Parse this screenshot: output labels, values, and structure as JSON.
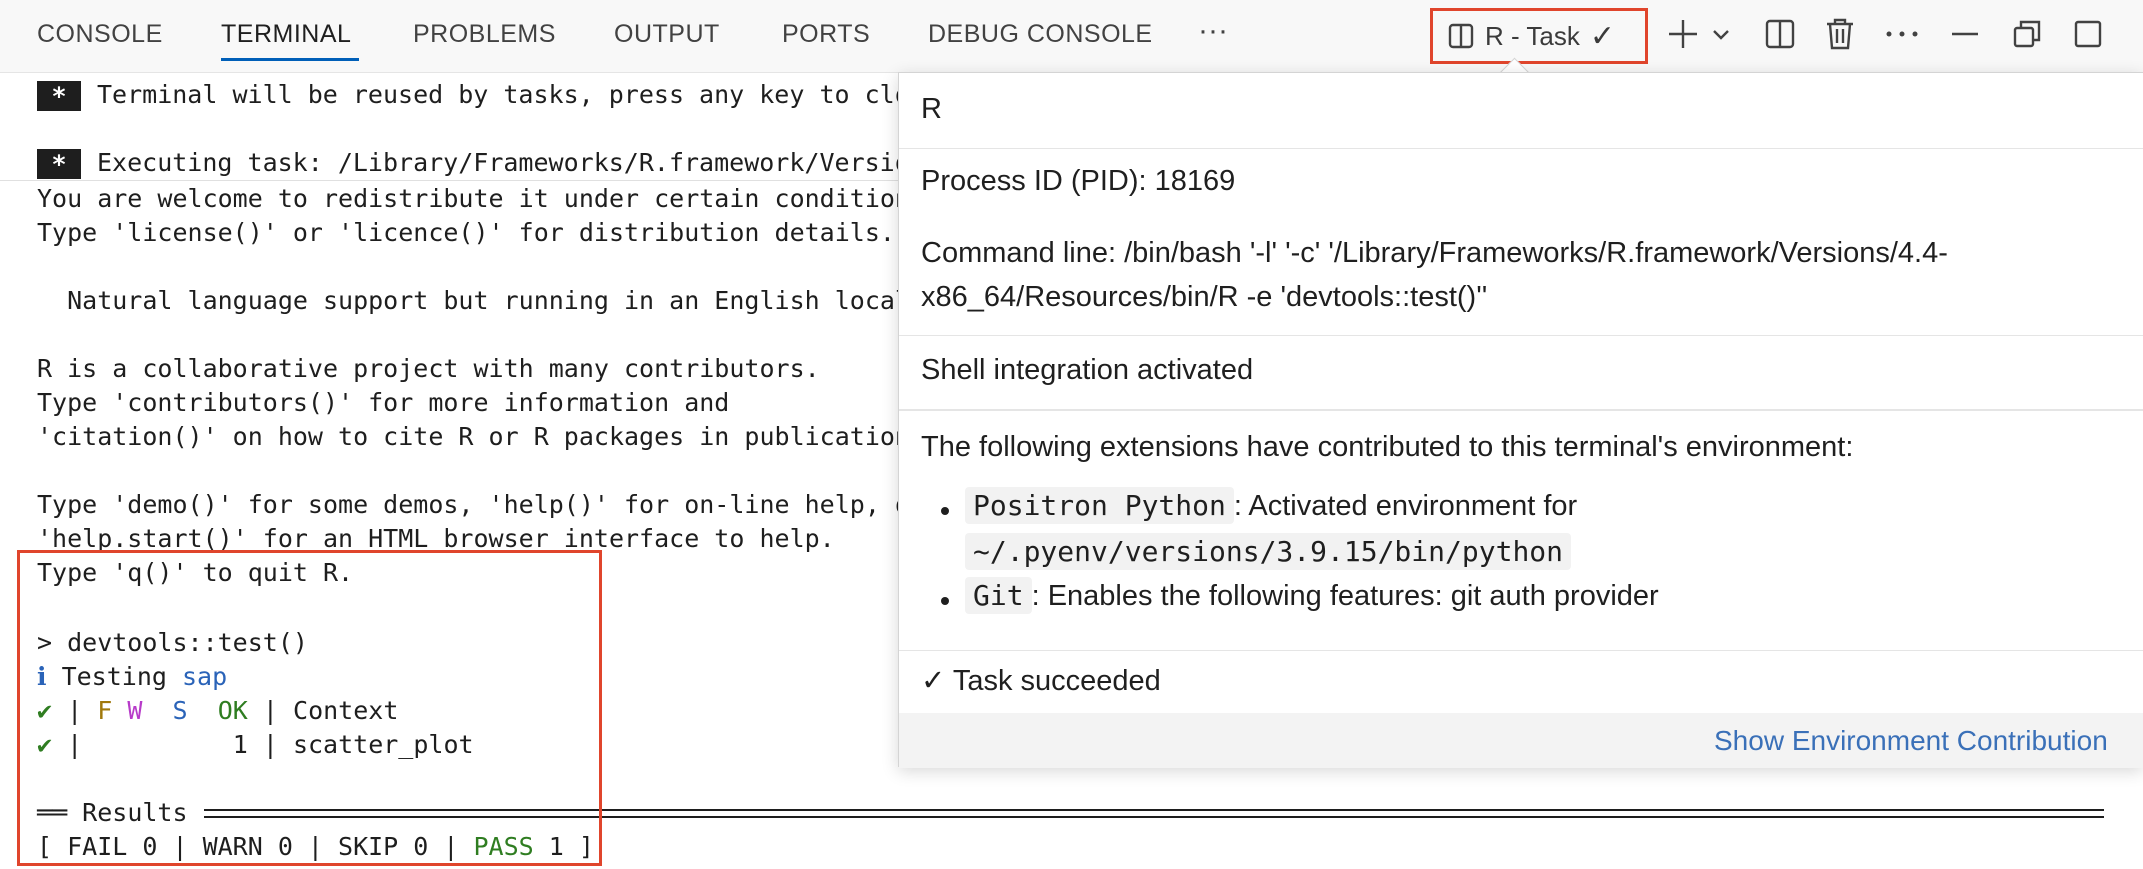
{
  "tabs": [
    "CONSOLE",
    "TERMINAL",
    "PROBLEMS",
    "OUTPUT",
    "PORTS",
    "DEBUG CONSOLE"
  ],
  "active_tab": "TERMINAL",
  "more_label": "···",
  "task_chip": {
    "label": "R - Task",
    "check": "✓"
  },
  "terminal": {
    "reuse_line": "Terminal will be reused by tasks, press any key to clo",
    "exec_line": "Executing task: /Library/Frameworks/R.framework/Versio",
    "star": "*",
    "lines": [
      "You are welcome to redistribute it under certain condition",
      "Type 'license()' or 'licence()' for distribution details.",
      "  Natural language support but running in an English local",
      "R is a collaborative project with many contributors.",
      "Type 'contributors()' for more information and",
      "'citation()' on how to cite R or R packages in publication",
      "Type 'demo()' for some demos, 'help()' for on-line help, o",
      "'help.start()' for an HTML browser interface to help.",
      "Type 'q()' to quit R."
    ],
    "test": {
      "command": "> devtools::test()",
      "info_icon": "ℹ",
      "testing_label": "Testing",
      "package": "sap",
      "check": "✔",
      "hdr_bar": "|",
      "hdr_f": "F",
      "hdr_w": "W",
      "hdr_s": "S",
      "hdr_ok": "OK",
      "hdr_bar2": "|",
      "hdr_context": "Context",
      "row_bar": "|",
      "row_ok": "1",
      "row_bar2": "|",
      "row_context": "scatter_plot",
      "results_prefix": "══",
      "results_label": "Results",
      "summary_open": "[ FAIL 0 | WARN 0 | SKIP 0 |",
      "summary_pass": "PASS",
      "summary_close": "1 ]"
    }
  },
  "hover": {
    "title": "R",
    "pid": "Process ID (PID): 18169",
    "cmd_line1": "Command line: /bin/bash '-l' '-c' '/Library/Frameworks/R.framework/Versions/4.4-",
    "cmd_line2": "x86_64/Resources/bin/R -e 'devtools::test()''",
    "shell": "Shell integration activated",
    "ext_intro": "The following extensions have contributed to this terminal's environment:",
    "ext1_name": "Positron Python",
    "ext1_desc": ": Activated environment for",
    "ext1_path": "~/.pyenv/versions/3.9.15/bin/python",
    "ext2_name": "Git",
    "ext2_desc": ": Enables the following features: git auth provider",
    "task_check": "✓",
    "task_status": "Task succeeded",
    "footer_link": "Show Environment Contribution"
  }
}
